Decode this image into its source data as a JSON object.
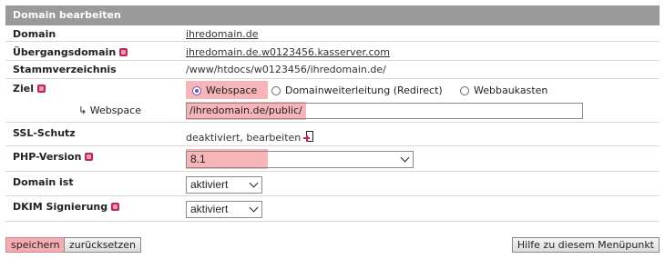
{
  "panel": {
    "title": "Domain bearbeiten"
  },
  "rows": {
    "domain": {
      "label": "Domain",
      "value": "ihredomain.de"
    },
    "uebergang": {
      "label": "Übergangsdomain",
      "value": "ihredomain.de.w0123456.kasserver.com"
    },
    "stamm": {
      "label": "Stammverzeichnis",
      "value": "/www/htdocs/w0123456/ihredomain.de/"
    },
    "ziel": {
      "label": "Ziel",
      "options": [
        "Webspace",
        "Domainweiterleitung (Redirect)",
        "Webbaukasten"
      ],
      "selected": "Webspace",
      "sub_label": "↳ Webspace",
      "path_value": "/ihredomain.de/public/"
    },
    "ssl": {
      "label": "SSL-Schutz",
      "value": "deaktiviert, bearbeiten"
    },
    "php": {
      "label": "PHP-Version",
      "value": "8.1"
    },
    "domain_ist": {
      "label": "Domain ist",
      "value": "aktiviert"
    },
    "dkim": {
      "label": "DKIM Signierung",
      "value": "aktiviert"
    }
  },
  "buttons": {
    "save": "speichern",
    "reset": "zurücksetzen",
    "help": "Hilfe zu diesem Menüpunkt"
  },
  "colors": {
    "header_bg": "#9a9a9a",
    "highlight": "#f6b5b8",
    "accent": "#c0245c",
    "radio": "#6a4fc0"
  }
}
